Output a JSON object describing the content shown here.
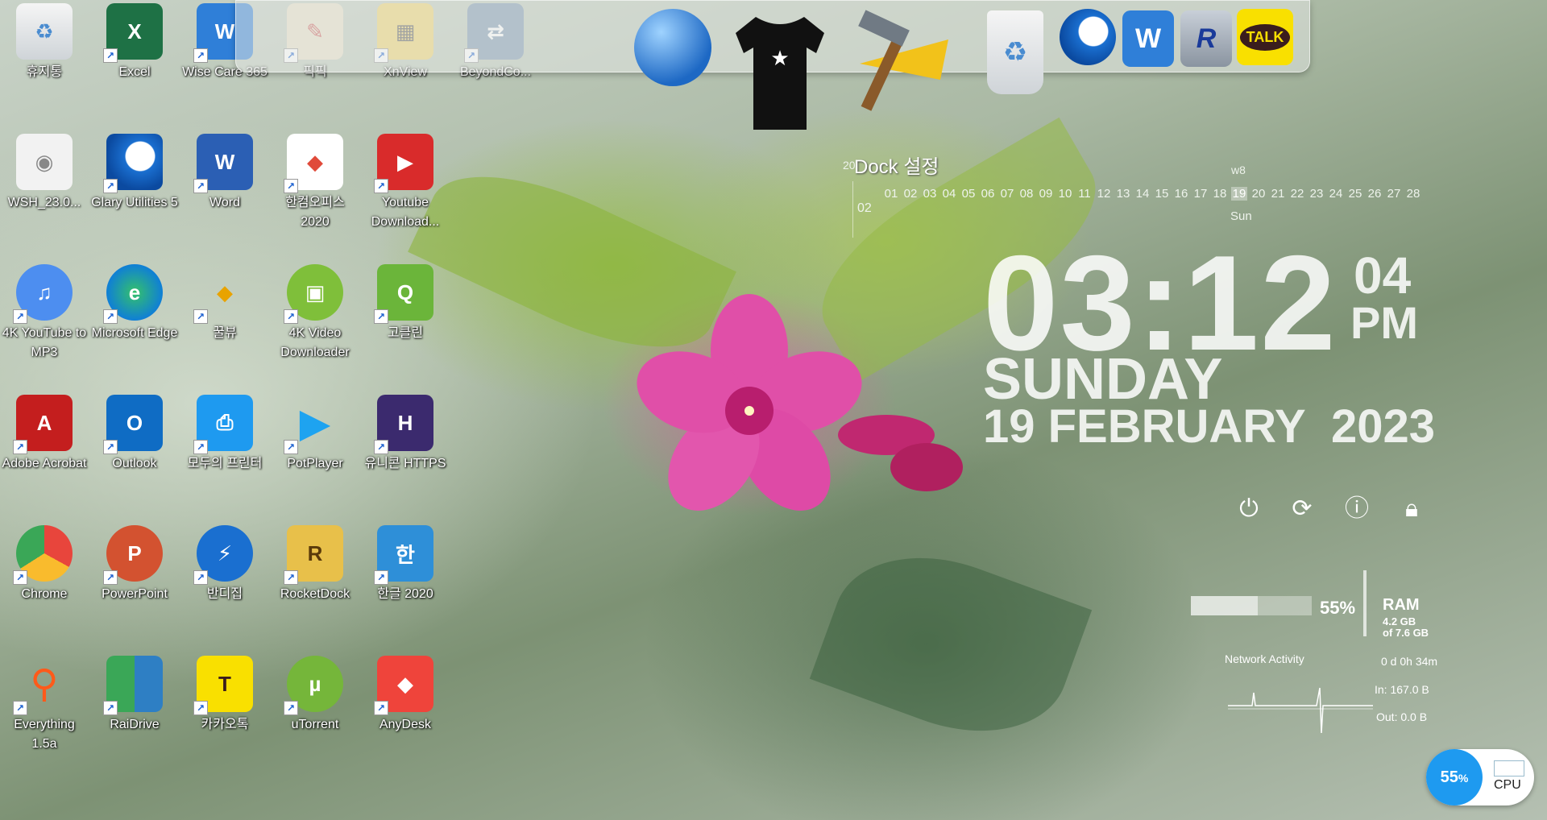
{
  "desktop": {
    "icons": [
      {
        "label": "휴지통",
        "icon": "recycle-bin-icon"
      },
      {
        "label": "Excel",
        "icon": "excel-icon"
      },
      {
        "label": "Wise Care 365",
        "icon": "wise-care-icon"
      },
      {
        "label": "픽픽",
        "icon": "picpick-icon"
      },
      {
        "label": "XnView",
        "icon": "xnview-icon"
      },
      {
        "label": "BeyondCo...",
        "icon": "beyond-compare-icon"
      },
      {
        "label": "WSH_23.0...",
        "icon": "file-icon"
      },
      {
        "label": "Glary Utilities 5",
        "icon": "glary-icon"
      },
      {
        "label": "Word",
        "icon": "word-icon"
      },
      {
        "label": "한컴오피스 2020",
        "icon": "hancom-icon"
      },
      {
        "label": "Youtube Download...",
        "icon": "youtube-download-icon"
      },
      {
        "label": "4K YouTube to MP3",
        "icon": "4k-youtube-mp3-icon"
      },
      {
        "label": "Microsoft Edge",
        "icon": "edge-icon"
      },
      {
        "label": "꿀뷰",
        "icon": "honeyview-icon"
      },
      {
        "label": "4K Video Downloader",
        "icon": "4k-video-downloader-icon"
      },
      {
        "label": "고클린",
        "icon": "goclean-icon"
      },
      {
        "label": "Adobe Acrobat",
        "icon": "acrobat-icon"
      },
      {
        "label": "Outlook",
        "icon": "outlook-icon"
      },
      {
        "label": "모두의 프린터",
        "icon": "printer-icon"
      },
      {
        "label": "PotPlayer",
        "icon": "potplayer-icon"
      },
      {
        "label": "유니콘 HTTPS",
        "icon": "unicorn-https-icon"
      },
      {
        "label": "Chrome",
        "icon": "chrome-icon"
      },
      {
        "label": "PowerPoint",
        "icon": "powerpoint-icon"
      },
      {
        "label": "반디집",
        "icon": "bandizip-icon"
      },
      {
        "label": "RocketDock",
        "icon": "rocketdock-icon"
      },
      {
        "label": "한글 2020",
        "icon": "hangul-icon"
      },
      {
        "label": "Everything 1.5a",
        "icon": "everything-icon"
      },
      {
        "label": "RaiDrive",
        "icon": "raidrive-icon"
      },
      {
        "label": "카카오톡",
        "icon": "kakaotalk-icon"
      },
      {
        "label": "uTorrent",
        "icon": "utorrent-icon"
      },
      {
        "label": "AnyDesk",
        "icon": "anydesk-icon"
      }
    ]
  },
  "dock": {
    "items": [
      "globe-icon",
      "tshirt-icon",
      "hammer-icon",
      "recycle-bin-icon",
      "glary-icon",
      "wise-care-icon",
      "registry-icon",
      "kakaotalk-icon"
    ],
    "kakao_text": "TALK"
  },
  "calendar": {
    "title": "Dock 설정",
    "year_prefix": "20",
    "week": "w8",
    "month": "02",
    "days": [
      "01",
      "02",
      "03",
      "04",
      "05",
      "06",
      "07",
      "08",
      "09",
      "10",
      "11",
      "12",
      "13",
      "14",
      "15",
      "16",
      "17",
      "18",
      "19",
      "20",
      "21",
      "22",
      "23",
      "24",
      "25",
      "26",
      "27",
      "28"
    ],
    "today": "19",
    "today_dow": "Sun"
  },
  "clock": {
    "time": "03:12",
    "seconds": "04",
    "ampm": "PM",
    "day": "SUNDAY",
    "date": "19 FEBRUARY",
    "year": "2023"
  },
  "power": {
    "buttons": [
      "power-icon",
      "restart-icon",
      "hibernate-icon",
      "lock-icon"
    ]
  },
  "ram": {
    "percent": "55%",
    "fraction": 0.55,
    "label": "RAM",
    "used": "4.2 GB",
    "total": "of 7.6 GB"
  },
  "network": {
    "label": "Network Activity",
    "uptime": "0 d 0h 34m",
    "in": "In: 167.0 B",
    "out": "Out: 0.0 B"
  },
  "cpu": {
    "percent": "55",
    "pct_sign": "%",
    "label": "CPU"
  },
  "colors": {
    "kakao_yellow": "#f9e000",
    "excel_green": "#1e7145",
    "word_blue": "#2b5fb4",
    "edge_blue": "#0f7fd6",
    "acrobat_red": "#c41e1e",
    "cpu_blue": "#1e9af0"
  }
}
